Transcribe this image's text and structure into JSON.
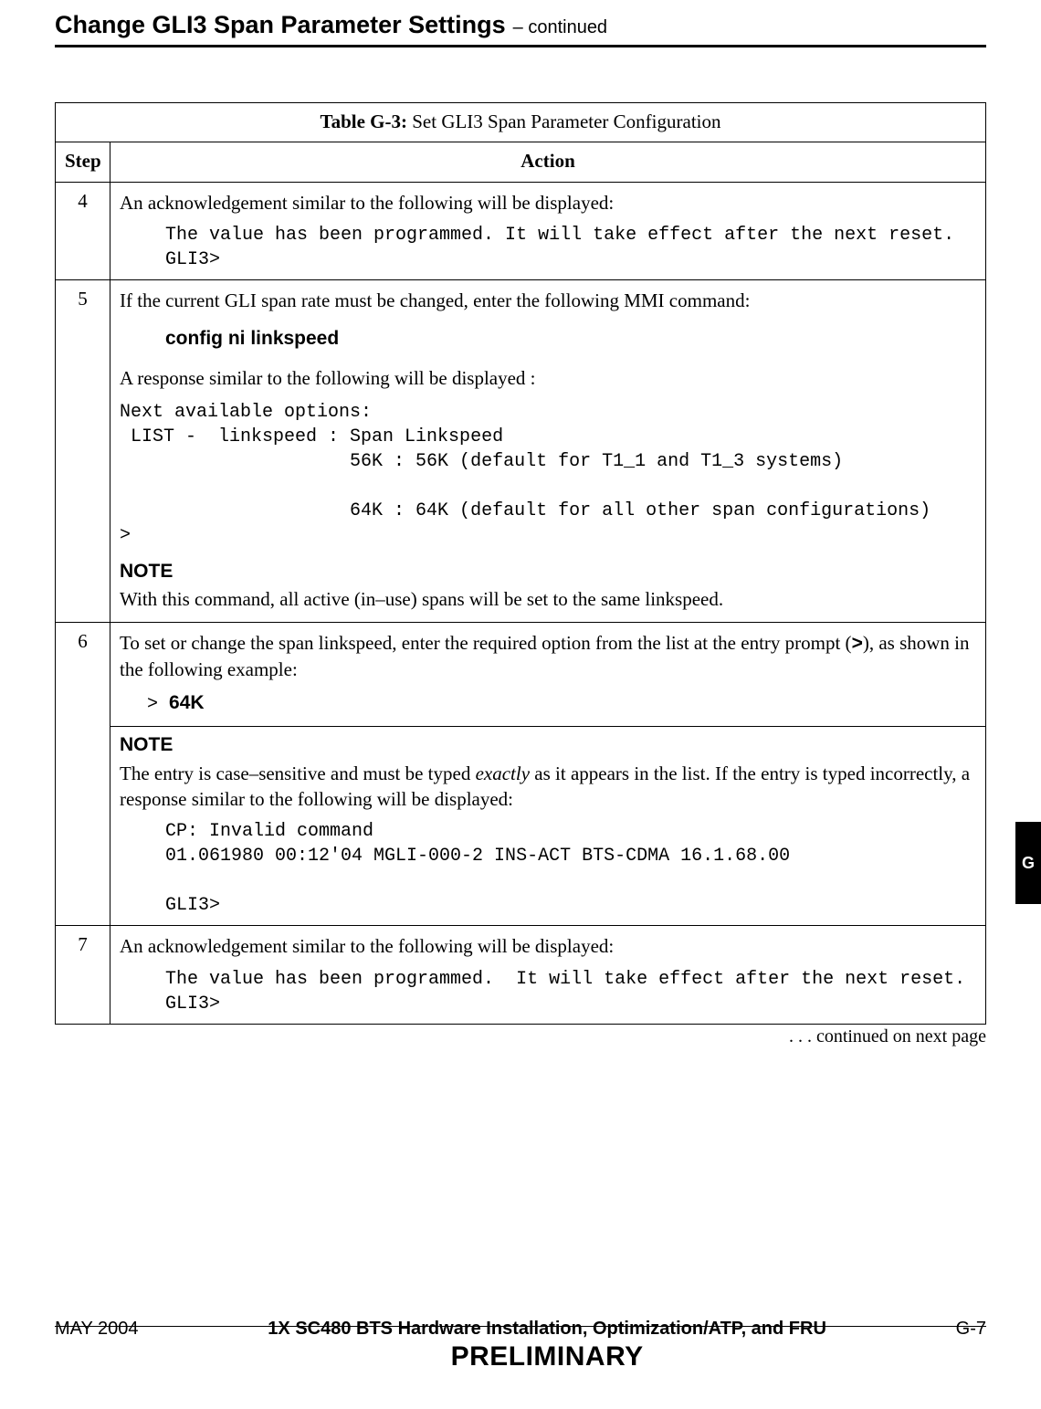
{
  "heading": {
    "title": "Change GLI3 Span Parameter Settings",
    "continued": " – continued"
  },
  "table": {
    "caption_prefix": "Table G-3:",
    "caption_rest": " Set GLI3 Span Parameter Configuration",
    "headers": {
      "step": "Step",
      "action": "Action"
    },
    "rows": {
      "r4": {
        "step": "4",
        "p1": "An acknowledgement similar to the following will be displayed:",
        "code": "The value has been programmed. It will take effect after the next reset.\nGLI3>"
      },
      "r5": {
        "step": "5",
        "p1": "If the current GLI span rate must be changed, enter the following MMI command:",
        "cmd": "config  ni  linkspeed",
        "p2": "A response similar to the following will be displayed :",
        "code": "Next available options:\n LIST -  linkspeed : Span Linkspeed\n                     56K : 56K (default for T1_1 and T1_3 systems)\n\n                     64K : 64K (default for all other span configurations)\n>",
        "note_head": "NOTE",
        "note_body": "With this command, all active (in–use) spans will be set to the same linkspeed."
      },
      "r6": {
        "step": "6",
        "p1_a": "To set or change the span linkspeed, enter the required option from the list at the entry prompt (",
        "p1_b": ">",
        "p1_c": "), as shown in the following example:",
        "prompt_sym": "> ",
        "prompt_val": "64K",
        "note_head": "NOTE",
        "note_a": "The entry is case–sensitive and must be typed ",
        "note_em": "exactly",
        "note_b": " as it appears in the list. If the entry is typed incorrectly, a response similar to the following will be displayed:",
        "code": "CP: Invalid command\n01.061980 00:12'04 MGLI-000-2 INS-ACT BTS-CDMA 16.1.68.00\n\nGLI3>"
      },
      "r7": {
        "step": "7",
        "p1": "An acknowledgement similar to the following will be displayed:",
        "code": "The value has been programmed.  It will take effect after the next reset.\nGLI3>"
      }
    },
    "continued_note": " . . . continued on next page"
  },
  "side_tab": "G",
  "footer": {
    "left": "MAY 2004",
    "center_doc": "1X SC480 BTS Hardware Installation, Optimization/ATP, and FRU",
    "center_prelim": "PRELIMINARY",
    "right": "G-7"
  }
}
